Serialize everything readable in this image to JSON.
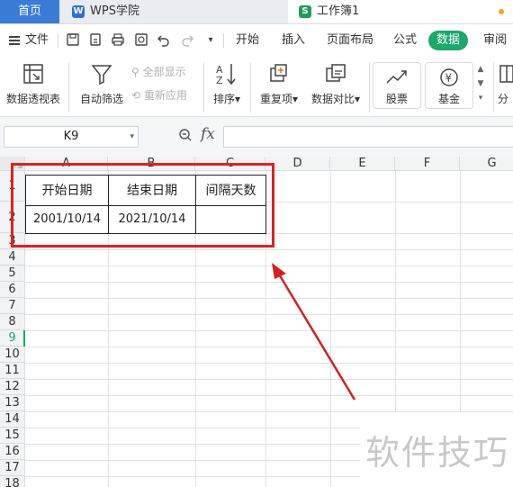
{
  "tabs": {
    "home": "首页",
    "wps_academy": "WPS学院",
    "workbook": "工作簿1",
    "wps_icon_letter": "W",
    "sheet_icon_letter": "S"
  },
  "menu": {
    "file": "文件",
    "items": [
      "开始",
      "插入",
      "页面布局",
      "公式",
      "数据",
      "审阅"
    ],
    "active": "数据"
  },
  "ribbon": {
    "pivot": "数据透视表",
    "autofilter": "自动筛选",
    "show_all": "全部显示",
    "reapply": "重新应用",
    "sort": "排序",
    "duplicates": "重复项",
    "compare": "数据对比",
    "stocks": "股票",
    "funds": "基金",
    "partial": "分"
  },
  "formula_bar": {
    "name_box": "K9",
    "fx": "fx",
    "value": ""
  },
  "sheet": {
    "columns": [
      "A",
      "B",
      "C",
      "D",
      "E",
      "F",
      "G"
    ],
    "rows": [
      "1",
      "2",
      "3",
      "4",
      "5",
      "6",
      "7",
      "8",
      "9",
      "10",
      "11",
      "12",
      "13",
      "14",
      "15",
      "16",
      "17",
      "18"
    ],
    "active_row": "9",
    "cells": {
      "A1": "开始日期",
      "B1": "结束日期",
      "C1": "间隔天数",
      "A2": "2001/10/14",
      "B2": "2021/10/14",
      "C2": ""
    }
  },
  "watermark": "软件技巧",
  "colors": {
    "accent_green": "#1aa86b",
    "home_tab_blue": "#3a7bd5",
    "annotation_red": "#e02020"
  }
}
